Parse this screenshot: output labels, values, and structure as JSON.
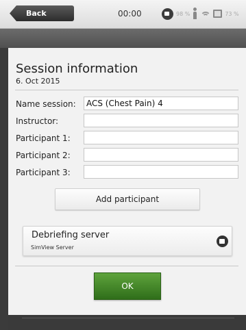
{
  "status_bar": {
    "back_label": "Back",
    "clock": "00:00",
    "battery_left": "98 %",
    "battery_right": "73 %"
  },
  "dialog": {
    "title": "Session information",
    "date": "6. Oct 2015",
    "fields": [
      {
        "label": "Name session:",
        "value": "ACS (Chest Pain) 4"
      },
      {
        "label": "Instructor:",
        "value": ""
      },
      {
        "label": "Participant 1:",
        "value": ""
      },
      {
        "label": "Participant 2:",
        "value": ""
      },
      {
        "label": "Participant 3:",
        "value": ""
      }
    ],
    "add_participant_label": "Add participant",
    "server": {
      "title": "Debriefing server",
      "subtitle": "SimView Server"
    },
    "ok_label": "OK"
  },
  "colors": {
    "ok_green": "#3f8a27",
    "dark_band": "#5a5a5a"
  }
}
